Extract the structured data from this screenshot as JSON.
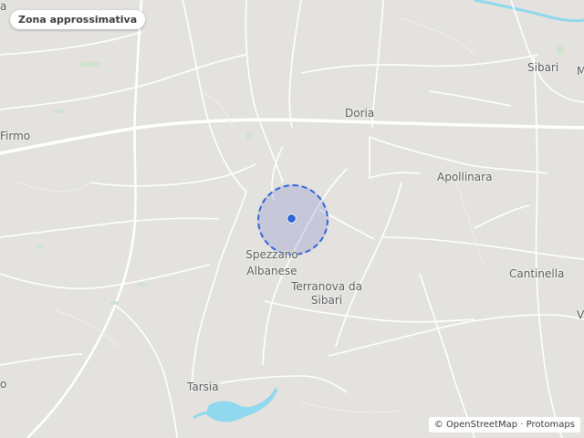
{
  "chip": {
    "label": "Zona approssimativa"
  },
  "places": {
    "sibari": "Sibari",
    "doria": "Doria",
    "firmo": "Firmo",
    "apollinara": "Apollinara",
    "spezzano_1": "Spezzano",
    "spezzano_2": "Albanese",
    "terranova_1": "Terranova da",
    "terranova_2": "Sibari",
    "cantinella": "Cantinella",
    "tarsia": "Tarsia",
    "edge_m": "M",
    "edge_v": "V",
    "edge_o": "o",
    "edge_a": "a"
  },
  "attribution": {
    "prefix": "©",
    "osm": "OpenStreetMap",
    "sep": "·",
    "protomaps": "Protomaps"
  },
  "colors": {
    "land": "#e4e2df",
    "road": "#ffffff",
    "water": "#8fd8ee",
    "accuracy_fill": "#5a6ec8",
    "accuracy_stroke": "#2f67d8",
    "location_dot": "#2f67d8"
  }
}
